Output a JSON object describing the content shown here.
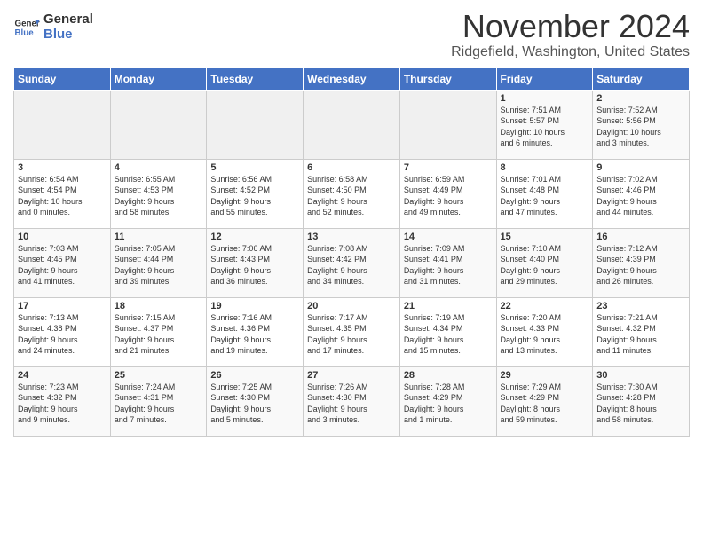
{
  "header": {
    "logo_line1": "General",
    "logo_line2": "Blue",
    "month": "November 2024",
    "location": "Ridgefield, Washington, United States"
  },
  "weekdays": [
    "Sunday",
    "Monday",
    "Tuesday",
    "Wednesday",
    "Thursday",
    "Friday",
    "Saturday"
  ],
  "weeks": [
    [
      {
        "day": "",
        "info": ""
      },
      {
        "day": "",
        "info": ""
      },
      {
        "day": "",
        "info": ""
      },
      {
        "day": "",
        "info": ""
      },
      {
        "day": "",
        "info": ""
      },
      {
        "day": "1",
        "info": "Sunrise: 7:51 AM\nSunset: 5:57 PM\nDaylight: 10 hours\nand 6 minutes."
      },
      {
        "day": "2",
        "info": "Sunrise: 7:52 AM\nSunset: 5:56 PM\nDaylight: 10 hours\nand 3 minutes."
      }
    ],
    [
      {
        "day": "3",
        "info": "Sunrise: 6:54 AM\nSunset: 4:54 PM\nDaylight: 10 hours\nand 0 minutes."
      },
      {
        "day": "4",
        "info": "Sunrise: 6:55 AM\nSunset: 4:53 PM\nDaylight: 9 hours\nand 58 minutes."
      },
      {
        "day": "5",
        "info": "Sunrise: 6:56 AM\nSunset: 4:52 PM\nDaylight: 9 hours\nand 55 minutes."
      },
      {
        "day": "6",
        "info": "Sunrise: 6:58 AM\nSunset: 4:50 PM\nDaylight: 9 hours\nand 52 minutes."
      },
      {
        "day": "7",
        "info": "Sunrise: 6:59 AM\nSunset: 4:49 PM\nDaylight: 9 hours\nand 49 minutes."
      },
      {
        "day": "8",
        "info": "Sunrise: 7:01 AM\nSunset: 4:48 PM\nDaylight: 9 hours\nand 47 minutes."
      },
      {
        "day": "9",
        "info": "Sunrise: 7:02 AM\nSunset: 4:46 PM\nDaylight: 9 hours\nand 44 minutes."
      }
    ],
    [
      {
        "day": "10",
        "info": "Sunrise: 7:03 AM\nSunset: 4:45 PM\nDaylight: 9 hours\nand 41 minutes."
      },
      {
        "day": "11",
        "info": "Sunrise: 7:05 AM\nSunset: 4:44 PM\nDaylight: 9 hours\nand 39 minutes."
      },
      {
        "day": "12",
        "info": "Sunrise: 7:06 AM\nSunset: 4:43 PM\nDaylight: 9 hours\nand 36 minutes."
      },
      {
        "day": "13",
        "info": "Sunrise: 7:08 AM\nSunset: 4:42 PM\nDaylight: 9 hours\nand 34 minutes."
      },
      {
        "day": "14",
        "info": "Sunrise: 7:09 AM\nSunset: 4:41 PM\nDaylight: 9 hours\nand 31 minutes."
      },
      {
        "day": "15",
        "info": "Sunrise: 7:10 AM\nSunset: 4:40 PM\nDaylight: 9 hours\nand 29 minutes."
      },
      {
        "day": "16",
        "info": "Sunrise: 7:12 AM\nSunset: 4:39 PM\nDaylight: 9 hours\nand 26 minutes."
      }
    ],
    [
      {
        "day": "17",
        "info": "Sunrise: 7:13 AM\nSunset: 4:38 PM\nDaylight: 9 hours\nand 24 minutes."
      },
      {
        "day": "18",
        "info": "Sunrise: 7:15 AM\nSunset: 4:37 PM\nDaylight: 9 hours\nand 21 minutes."
      },
      {
        "day": "19",
        "info": "Sunrise: 7:16 AM\nSunset: 4:36 PM\nDaylight: 9 hours\nand 19 minutes."
      },
      {
        "day": "20",
        "info": "Sunrise: 7:17 AM\nSunset: 4:35 PM\nDaylight: 9 hours\nand 17 minutes."
      },
      {
        "day": "21",
        "info": "Sunrise: 7:19 AM\nSunset: 4:34 PM\nDaylight: 9 hours\nand 15 minutes."
      },
      {
        "day": "22",
        "info": "Sunrise: 7:20 AM\nSunset: 4:33 PM\nDaylight: 9 hours\nand 13 minutes."
      },
      {
        "day": "23",
        "info": "Sunrise: 7:21 AM\nSunset: 4:32 PM\nDaylight: 9 hours\nand 11 minutes."
      }
    ],
    [
      {
        "day": "24",
        "info": "Sunrise: 7:23 AM\nSunset: 4:32 PM\nDaylight: 9 hours\nand 9 minutes."
      },
      {
        "day": "25",
        "info": "Sunrise: 7:24 AM\nSunset: 4:31 PM\nDaylight: 9 hours\nand 7 minutes."
      },
      {
        "day": "26",
        "info": "Sunrise: 7:25 AM\nSunset: 4:30 PM\nDaylight: 9 hours\nand 5 minutes."
      },
      {
        "day": "27",
        "info": "Sunrise: 7:26 AM\nSunset: 4:30 PM\nDaylight: 9 hours\nand 3 minutes."
      },
      {
        "day": "28",
        "info": "Sunrise: 7:28 AM\nSunset: 4:29 PM\nDaylight: 9 hours\nand 1 minute."
      },
      {
        "day": "29",
        "info": "Sunrise: 7:29 AM\nSunset: 4:29 PM\nDaylight: 8 hours\nand 59 minutes."
      },
      {
        "day": "30",
        "info": "Sunrise: 7:30 AM\nSunset: 4:28 PM\nDaylight: 8 hours\nand 58 minutes."
      }
    ]
  ]
}
